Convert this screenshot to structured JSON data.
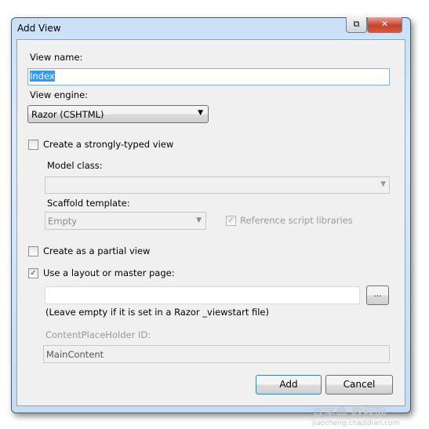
{
  "window": {
    "title": "Add View"
  },
  "fields": {
    "view_name_label": "View name:",
    "view_name_value": "Index",
    "view_engine_label": "View engine:",
    "view_engine_value": "Razor (CSHTML)",
    "strongly_typed_label": "Create a strongly-typed view",
    "strongly_typed_checked": false,
    "model_class_label": "Model class:",
    "model_class_value": "",
    "scaffold_label": "Scaffold template:",
    "scaffold_value": "Empty",
    "reference_scripts_label": "Reference script libraries",
    "reference_scripts_checked": true,
    "partial_label": "Create as a partial view",
    "partial_checked": false,
    "layout_label": "Use a layout or master page:",
    "layout_checked": true,
    "layout_value": "",
    "browse_label": "...",
    "layout_hint": "(Leave empty if it is set in a Razor _viewstart file)",
    "cph_label": "ContentPlaceHolder ID:",
    "cph_value": "MainContent"
  },
  "buttons": {
    "add": "Add",
    "cancel": "Cancel"
  },
  "watermark": {
    "text": "查字典 教程网",
    "url": "jiaocheng.chazidian.com"
  },
  "colors": {
    "selection": "#3399ff",
    "focus_border": "#3c7fb1"
  }
}
